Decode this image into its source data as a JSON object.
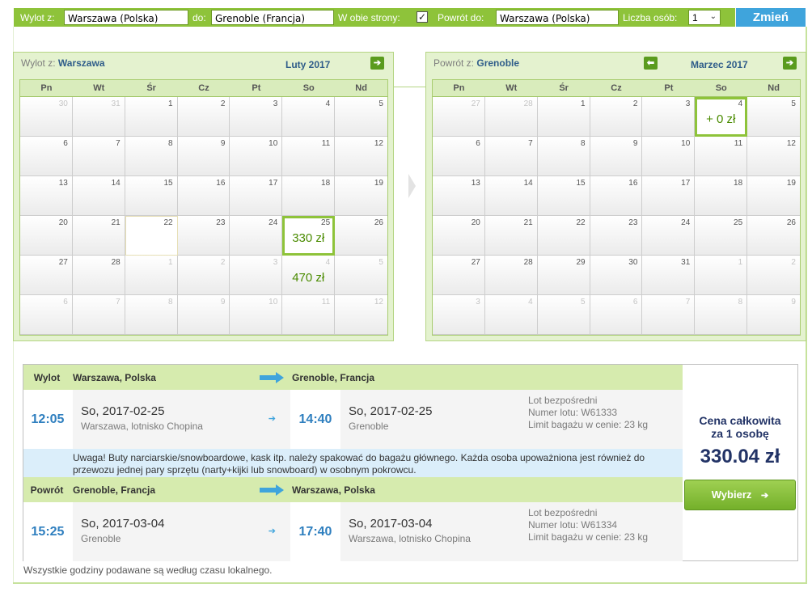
{
  "search": {
    "from_label": "Wylot z:",
    "from_value": "Warszawa (Polska)",
    "to_label": "do:",
    "to_value": "Grenoble (Francja)",
    "roundtrip_label": "W obie strony:",
    "roundtrip_checked": "✓",
    "return_label": "Powrót do:",
    "return_value": "Warszawa (Polska)",
    "persons_label": "Liczba osób:",
    "persons_value": "1",
    "change_button": "Zmień"
  },
  "weekdays": [
    "Pn",
    "Wt",
    "Śr",
    "Cz",
    "Pt",
    "So",
    "Nd"
  ],
  "outbound_calendar": {
    "title_prefix": "Wylot z:",
    "city": "Warszawa",
    "month": "Luty 2017",
    "days": [
      {
        "d": "30",
        "dim": true
      },
      {
        "d": "31",
        "dim": true
      },
      {
        "d": "1"
      },
      {
        "d": "2"
      },
      {
        "d": "3"
      },
      {
        "d": "4"
      },
      {
        "d": "5"
      },
      {
        "d": "6"
      },
      {
        "d": "7"
      },
      {
        "d": "8"
      },
      {
        "d": "9"
      },
      {
        "d": "10"
      },
      {
        "d": "11"
      },
      {
        "d": "12"
      },
      {
        "d": "13"
      },
      {
        "d": "14"
      },
      {
        "d": "15"
      },
      {
        "d": "16"
      },
      {
        "d": "17"
      },
      {
        "d": "18"
      },
      {
        "d": "19"
      },
      {
        "d": "20"
      },
      {
        "d": "21"
      },
      {
        "d": "22",
        "today": true
      },
      {
        "d": "23"
      },
      {
        "d": "24"
      },
      {
        "d": "25",
        "price": "330 zł",
        "selected": true
      },
      {
        "d": "26"
      },
      {
        "d": "27"
      },
      {
        "d": "28"
      },
      {
        "d": "1",
        "dim": true
      },
      {
        "d": "2",
        "dim": true
      },
      {
        "d": "3",
        "dim": true
      },
      {
        "d": "4",
        "dim": true,
        "price": "470 zł"
      },
      {
        "d": "5",
        "dim": true
      },
      {
        "d": "6",
        "dim": true
      },
      {
        "d": "7",
        "dim": true
      },
      {
        "d": "8",
        "dim": true
      },
      {
        "d": "9",
        "dim": true
      },
      {
        "d": "10",
        "dim": true
      },
      {
        "d": "11",
        "dim": true
      },
      {
        "d": "12",
        "dim": true
      }
    ]
  },
  "return_calendar": {
    "title_prefix": "Powrót z:",
    "city": "Grenoble",
    "month": "Marzec 2017",
    "days": [
      {
        "d": "27",
        "dim": true
      },
      {
        "d": "28",
        "dim": true
      },
      {
        "d": "1"
      },
      {
        "d": "2"
      },
      {
        "d": "3"
      },
      {
        "d": "4",
        "price": "+ 0 zł",
        "selected": true
      },
      {
        "d": "5"
      },
      {
        "d": "6"
      },
      {
        "d": "7"
      },
      {
        "d": "8"
      },
      {
        "d": "9"
      },
      {
        "d": "10"
      },
      {
        "d": "11"
      },
      {
        "d": "12"
      },
      {
        "d": "13"
      },
      {
        "d": "14"
      },
      {
        "d": "15"
      },
      {
        "d": "16"
      },
      {
        "d": "17"
      },
      {
        "d": "18"
      },
      {
        "d": "19"
      },
      {
        "d": "20"
      },
      {
        "d": "21"
      },
      {
        "d": "22"
      },
      {
        "d": "23"
      },
      {
        "d": "24"
      },
      {
        "d": "25"
      },
      {
        "d": "26"
      },
      {
        "d": "27"
      },
      {
        "d": "28"
      },
      {
        "d": "29"
      },
      {
        "d": "30"
      },
      {
        "d": "31"
      },
      {
        "d": "1",
        "dim": true
      },
      {
        "d": "2",
        "dim": true
      },
      {
        "d": "3",
        "dim": true
      },
      {
        "d": "4",
        "dim": true
      },
      {
        "d": "5",
        "dim": true
      },
      {
        "d": "6",
        "dim": true
      },
      {
        "d": "7",
        "dim": true
      },
      {
        "d": "8",
        "dim": true
      },
      {
        "d": "9",
        "dim": true
      }
    ]
  },
  "outbound": {
    "label": "Wylot",
    "from": "Warszawa, Polska",
    "to": "Grenoble, Francja",
    "dep_time": "12:05",
    "dep_date": "So, 2017-02-25",
    "dep_place": "Warszawa, lotnisko Chopina",
    "arr_time": "14:40",
    "arr_date": "So, 2017-02-25",
    "arr_place": "Grenoble",
    "meta1": "Lot bezpośredni",
    "meta2": "Numer lotu: W61333",
    "meta3": "Limit bagażu w cenie: 23 kg"
  },
  "notice": "Uwaga! Buty narciarskie/snowboardowe, kask itp. należy spakować do bagażu głównego. Każda osoba upoważniona jest również do przewozu jednej pary sprzętu (narty+kijki lub snowboard) w osobnym pokrowcu.",
  "inbound": {
    "label": "Powrót",
    "from": "Grenoble, Francja",
    "to": "Warszawa, Polska",
    "dep_time": "15:25",
    "dep_date": "So, 2017-03-04",
    "dep_place": "Grenoble",
    "arr_time": "17:40",
    "arr_date": "So, 2017-03-04",
    "arr_place": "Warszawa, lotnisko Chopina",
    "meta1": "Lot bezpośredni",
    "meta2": "Numer lotu: W61334",
    "meta3": "Limit bagażu w cenie: 23 kg"
  },
  "price": {
    "label_line1": "Cena całkowita",
    "label_line2": "za 1 osobę",
    "value": "330.04 zł",
    "select_button": "Wybierz"
  },
  "footnote": "Wszystkie godziny podawane są według czasu lokalnego.",
  "colors": {
    "accent_green": "#8ec33a",
    "accent_blue": "#3fa4dc",
    "price_navy": "#223366"
  }
}
